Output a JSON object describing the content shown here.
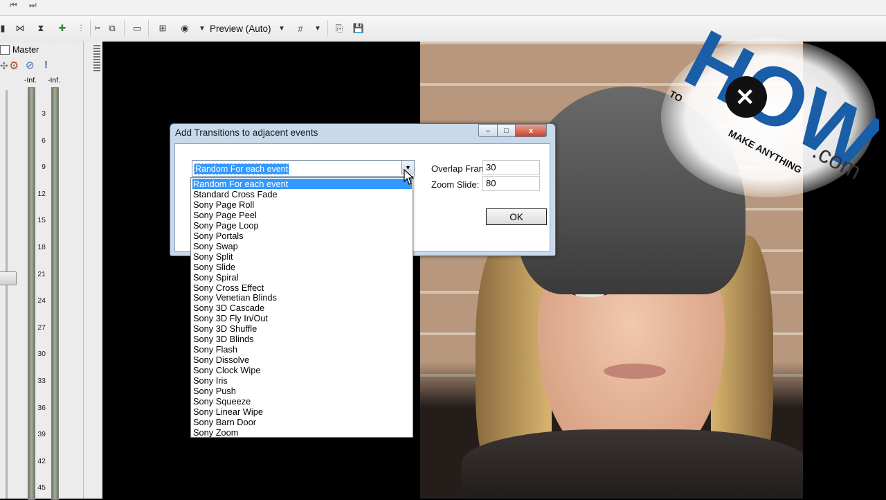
{
  "toolbar": {
    "preview_label": "Preview (Auto)",
    "icons": [
      "skip-start-icon",
      "skip-end-icon",
      "trim-icon",
      "mute-icon",
      "pin-icon",
      "auto-ripple-icon",
      "select-icon",
      "external-monitor-icon",
      "split-screen-icon",
      "preview-quality-icon",
      "grid-icon",
      "copy-snapshot-icon",
      "save-snapshot-icon"
    ]
  },
  "mixer": {
    "title": "Master",
    "peak_left": "-Inf.",
    "peak_right": "-Inf.",
    "scale": [
      "3",
      "6",
      "9",
      "12",
      "15",
      "18",
      "21",
      "24",
      "27",
      "30",
      "33",
      "36",
      "39",
      "42",
      "45"
    ]
  },
  "dialog": {
    "title": "Add Transitions to adjacent events",
    "selected": "Random For each event",
    "overlap_label": "Overlap Frames:",
    "overlap_value": "30",
    "zoom_label": "Zoom Slide:",
    "zoom_value": "80",
    "ok_label": "OK",
    "minimize": "–",
    "maximize": "□",
    "close": "x"
  },
  "dropdown": {
    "options": [
      "Random For each event",
      "Standard Cross Fade",
      "Sony Page Roll",
      "Sony Page Peel",
      "Sony Page Loop",
      "Sony Portals",
      "Sony Swap",
      "Sony Split",
      "Sony Slide",
      "Sony Spiral",
      "Sony Cross Effect",
      "Sony Venetian Blinds",
      "Sony 3D Cascade",
      "Sony 3D Fly In/Out",
      "Sony 3D Shuffle",
      "Sony 3D Blinds",
      "Sony Flash",
      "Sony Dissolve",
      "Sony Clock Wipe",
      "Sony Iris",
      "Sony Push",
      "Sony Squeeze",
      "Sony Linear Wipe",
      "Sony Barn Door",
      "Sony Zoom"
    ],
    "highlighted_index": 0
  },
  "logo": {
    "big": "HOW",
    "to": "TO",
    "make": "MAKE ANYTHING",
    "com": ".com",
    "colors": {
      "blue": "#1a5ea8",
      "dark": "#111111",
      "white": "#ffffff"
    }
  }
}
